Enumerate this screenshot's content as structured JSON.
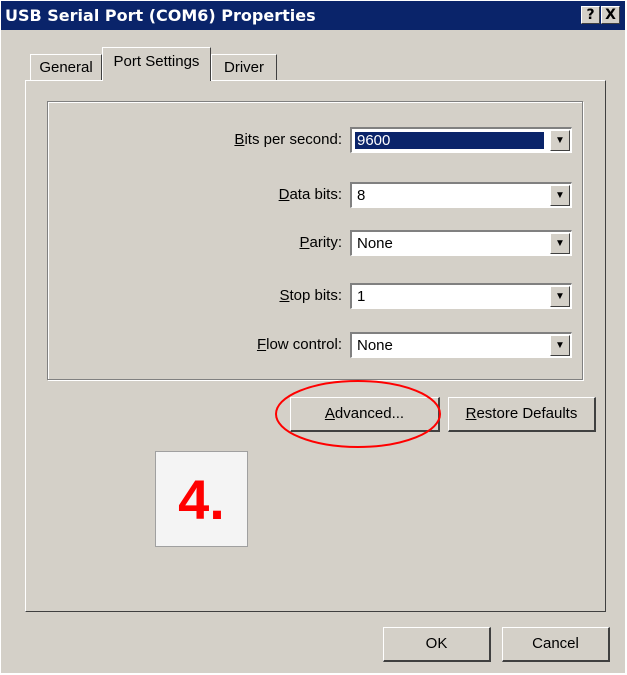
{
  "window": {
    "title": "USB Serial Port (COM6) Properties"
  },
  "caption_buttons": {
    "help": "?",
    "close": "X"
  },
  "tabs": [
    {
      "label": "General"
    },
    {
      "label": "Port Settings",
      "selected": true
    },
    {
      "label": "Driver"
    }
  ],
  "settings": [
    {
      "access_key": "B",
      "label_rest": "its per second:",
      "value": "9600",
      "selected": true
    },
    {
      "access_key": "D",
      "label_rest": "ata bits:",
      "value": "8"
    },
    {
      "access_key": "P",
      "label_rest": "arity:",
      "value": "None"
    },
    {
      "access_key": "S",
      "label_rest": "top bits:",
      "value": "1"
    },
    {
      "access_key": "F",
      "label_rest": "low control:",
      "value": "None"
    }
  ],
  "buttons": {
    "advanced_key": "A",
    "advanced_rest": "dvanced...",
    "restore_key": "R",
    "restore_rest": "estore Defaults",
    "ok": "OK",
    "cancel": "Cancel"
  },
  "annotation": {
    "step": "4.",
    "color": "#ff0000"
  },
  "colors": {
    "titlebar": "#0a246a",
    "face": "#d4d0c8",
    "selection": "#0a246a"
  }
}
